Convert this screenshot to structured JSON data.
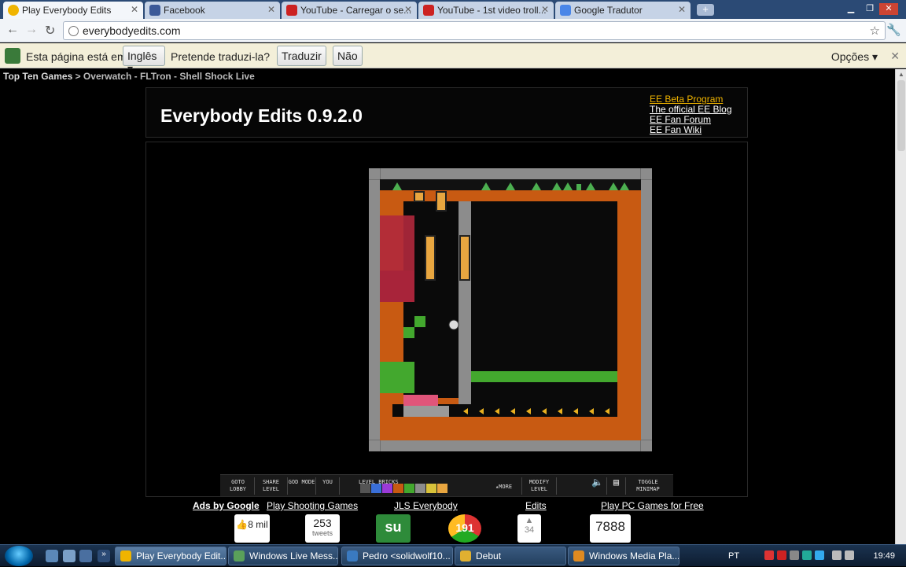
{
  "browser": {
    "tabs": [
      {
        "title": "Play Everybody Edits",
        "icon": "smiley-icon",
        "color": "#f0b400"
      },
      {
        "title": "Facebook",
        "icon": "facebook-icon",
        "color": "#3b5998"
      },
      {
        "title": "YouTube - Carregar o se...",
        "icon": "youtube-icon",
        "color": "#cc2222"
      },
      {
        "title": "YouTube - 1st video troll...",
        "icon": "youtube-icon",
        "color": "#cc2222"
      },
      {
        "title": "Google Tradutor",
        "icon": "translate-icon",
        "color": "#4a86e8"
      }
    ],
    "url": "everybodyedits.com"
  },
  "translate_bar": {
    "prefix": "Esta página está em",
    "language": "Inglês",
    "question": "Pretende traduzi-la?",
    "translate_button": "Traduzir",
    "no_button": "Não",
    "options": "Opções"
  },
  "page": {
    "top_nav_lead": "Top Ten Games",
    "top_nav_rest": "> Overwatch - FLTron - Shell Shock Live",
    "site_title": "Everybody Edits 0.9.2.0",
    "links": [
      "EE Beta Program",
      "The official EE Blog",
      "EE Fan Forum",
      "EE Fan Wiki"
    ]
  },
  "game_menu": {
    "goto_lobby": "GOTO LOBBY",
    "share_level": "SHARE LEVEL",
    "god_mode": "GOD MODE",
    "you": "YOU",
    "level_bricks": "LEVEL BRICKS",
    "more": "MORE",
    "modify_level": "MODIFY LEVEL",
    "toggle_minimap": "TOGGLE MINIMAP"
  },
  "ads": {
    "ads_by_google": "Ads by Google",
    "items": [
      "Play Shooting Games",
      "JLS Everybody",
      "Edits",
      "Play PC Games for Free"
    ]
  },
  "social": {
    "fb_likes": "8 mil",
    "tweets_count": "253",
    "tweets_label": "tweets",
    "stumble": "191",
    "digg": "34",
    "other": "7888"
  },
  "taskbar": {
    "items": [
      {
        "label": "Play Everybody Edit...",
        "color": "#f0b400"
      },
      {
        "label": "Windows Live Mess...",
        "color": "#5aa05a"
      },
      {
        "label": "Pedro <solidwolf10...",
        "color": "#3a7ac0"
      },
      {
        "label": "Debut",
        "color": "#e0b030"
      },
      {
        "label": "Windows Media Pla...",
        "color": "#e08a20"
      }
    ],
    "lang": "PT",
    "time": "19:49"
  }
}
